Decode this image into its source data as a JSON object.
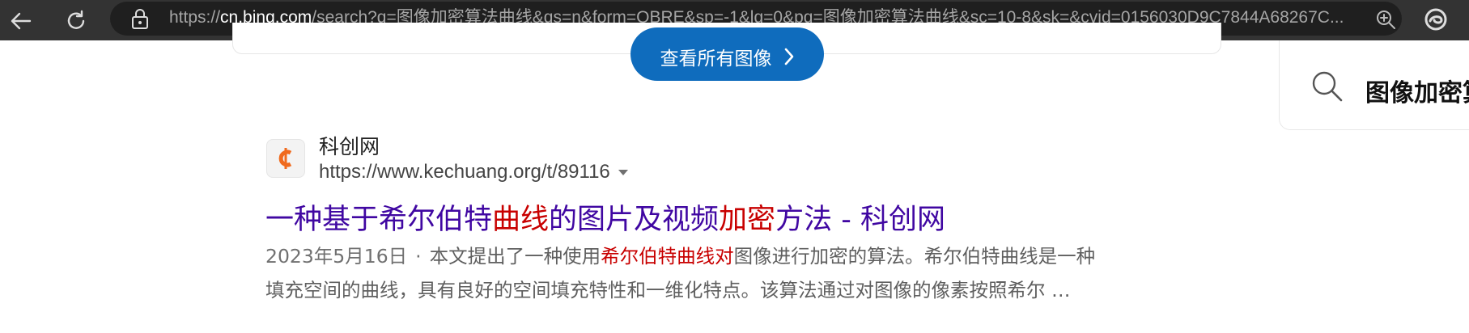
{
  "browser": {
    "url_host": "cn.bing.com",
    "url_scheme": "https://",
    "url_rest": "/search?q=图像加密算法曲线&qs=n&form=QBRE&sp=-1&lq=0&pq=图像加密算法曲线&sc=10-8&sk=&cvid=0156030D9C7844A68267C...",
    "icons": [
      "back-icon",
      "refresh-icon",
      "lock-icon",
      "zoom-icon",
      "edge-logo-icon"
    ]
  },
  "images_section": {
    "see_all_label": "查看所有图像",
    "accent_color": "#0f6cbd"
  },
  "right_panel": {
    "title": "图像加密算"
  },
  "result": {
    "site_name": "科创网",
    "site_url": "https://www.kechuang.org/t/89116",
    "title_parts": [
      {
        "text": "一种基于希尔伯特",
        "hl": false
      },
      {
        "text": "曲线",
        "hl": true
      },
      {
        "text": "的图片及视频",
        "hl": false
      },
      {
        "text": "加密",
        "hl": true
      },
      {
        "text": "方法 - 科创网",
        "hl": false
      }
    ],
    "date": "2023年5月16日",
    "separator": "·",
    "snippet_line1_a": "本文提出了一种使用",
    "snippet_line1_hl": "希尔伯特曲线对",
    "snippet_line1_b": "图像进行加密的算法。希尔伯特曲线是一种",
    "snippet_line2": "填充空间的曲线，具有良好的空间填充特性和一维化特点。该算法通过对图像的像素按照希尔 …",
    "title_color": "#4007a2",
    "highlight_color": "#c80000"
  }
}
